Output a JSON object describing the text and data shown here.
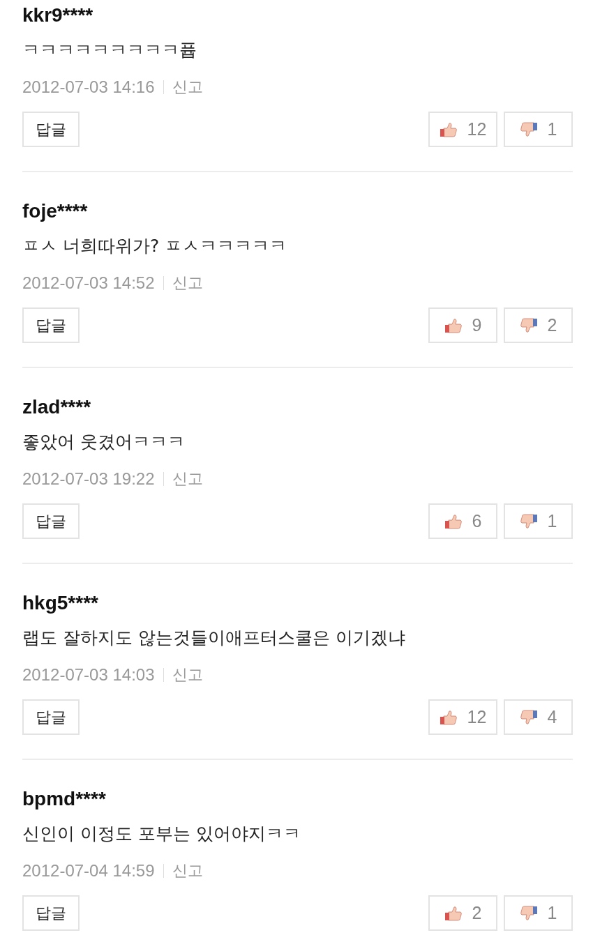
{
  "comments": [
    {
      "user": "kkr9****",
      "text": "ㅋㅋㅋㅋㅋㅋㅋㅋㅋ퓹",
      "date": "2012-07-03 14:16",
      "report": "신고",
      "reply": "답글",
      "likes": "12",
      "dislikes": "1"
    },
    {
      "user": "foje****",
      "text": "ㅍㅅ 너희따위가? ㅍㅅㅋㅋㅋㅋㅋ",
      "date": "2012-07-03 14:52",
      "report": "신고",
      "reply": "답글",
      "likes": "9",
      "dislikes": "2"
    },
    {
      "user": "zlad****",
      "text": "좋았어 웃겼어ㅋㅋㅋ",
      "date": "2012-07-03 19:22",
      "report": "신고",
      "reply": "답글",
      "likes": "6",
      "dislikes": "1"
    },
    {
      "user": "hkg5****",
      "text": "랩도 잘하지도 않는것들이애프터스쿨은 이기겠냐",
      "date": "2012-07-03 14:03",
      "report": "신고",
      "reply": "답글",
      "likes": "12",
      "dislikes": "4"
    },
    {
      "user": "bpmd****",
      "text": "신인이 이정도 포부는 있어야지ㅋㅋ",
      "date": "2012-07-04 14:59",
      "report": "신고",
      "reply": "답글",
      "likes": "2",
      "dislikes": "1"
    }
  ]
}
